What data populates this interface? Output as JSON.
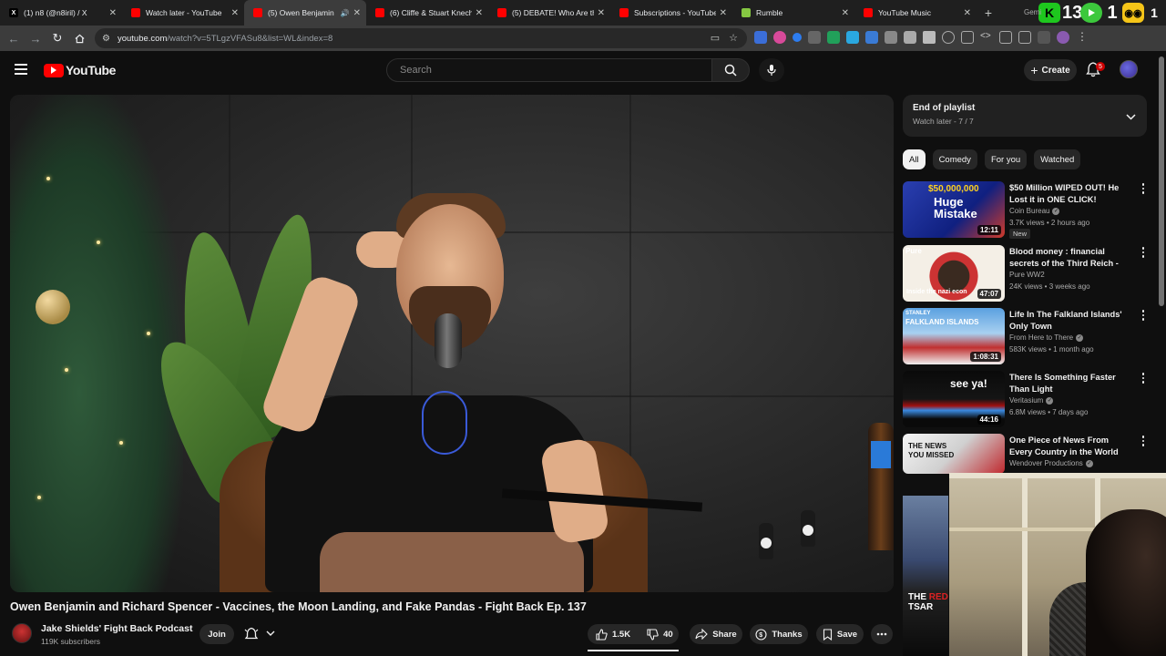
{
  "browser": {
    "tabs": [
      {
        "title": "(1) n8 (@n8iril) / X",
        "fav": "X",
        "fav_color": "#000000",
        "fav_fg": "#ffffff",
        "active": false
      },
      {
        "title": "Watch later - YouTube",
        "fav": "",
        "fav_color": "#ff0000",
        "fav_fg": "#ffffff",
        "active": false
      },
      {
        "title": "(5) Owen Benjamin",
        "fav": "",
        "fav_color": "#ff0000",
        "fav_fg": "#ffffff",
        "active": true
      },
      {
        "title": "(6) Cliffe & Stuart Knech",
        "fav": "",
        "fav_color": "#ff0000",
        "fav_fg": "#ffffff",
        "active": false
      },
      {
        "title": "(5) DEBATE! Who Are th",
        "fav": "",
        "fav_color": "#ff0000",
        "fav_fg": "#ffffff",
        "active": false
      },
      {
        "title": "Subscriptions - YouTube",
        "fav": "",
        "fav_color": "#ff0000",
        "fav_fg": "#ffffff",
        "active": false
      },
      {
        "title": "Rumble",
        "fav": "",
        "fav_color": "#85c742",
        "fav_fg": "#ffffff",
        "active": false
      },
      {
        "title": "YouTube Music",
        "fav": "",
        "fav_color": "#ff0000",
        "fav_fg": "#ffffff",
        "active": false
      }
    ],
    "ext_counter": "13",
    "ext_counter2": "1",
    "gemini_fragment": "Gemi",
    "url_host": "youtube.com",
    "url_rest": "/watch?v=5TLgzVFASu8&list=WL&index=8"
  },
  "youtube": {
    "logo_text": "YouTube",
    "search_placeholder": "Search",
    "create_label": "Create",
    "notif_count": "5"
  },
  "video": {
    "title": "Owen Benjamin and Richard Spencer - Vaccines, the Moon Landing, and Fake Pandas - Fight Back Ep. 137",
    "channel": "Jake Shields' Fight Back Podcast",
    "subscribers": "119K subscribers",
    "join_label": "Join",
    "likes": "1.5K",
    "dislikes": "40",
    "share_label": "Share",
    "thanks_label": "Thanks",
    "save_label": "Save"
  },
  "playlist": {
    "title": "End of playlist",
    "subtitle": "Watch later - 7 / 7"
  },
  "chips": [
    "All",
    "Comedy",
    "For you",
    "Watched"
  ],
  "recommendations": [
    {
      "title": "$50 Million WIPED OUT! He Lost it in ONE CLICK!",
      "channel": "Coin Bureau",
      "meta": "3.7K views • 2 hours ago",
      "duration": "12:11",
      "badge": "New",
      "thumb_text": "$50,000,000",
      "thumb_text2": "Huge Mistake"
    },
    {
      "title": "Blood money : financial secrets of the Third Reich - episode 1 :...",
      "channel": "Pure WW2",
      "meta": "24K views • 3 weeks ago",
      "duration": "47:07",
      "badge": "",
      "thumb_text": "Pure",
      "thumb_text2": "Inside the nazi econ"
    },
    {
      "title": "Life In The Falkland Islands' Only Town",
      "channel": "From Here to There",
      "meta": "583K views • 1 month ago",
      "duration": "1:08:31",
      "badge": "",
      "thumb_text": "STANLEY",
      "thumb_text2": "FALKLAND ISLANDS"
    },
    {
      "title": "There Is Something Faster Than Light",
      "channel": "Veritasium",
      "meta": "6.8M views • 7 days ago",
      "duration": "44:16",
      "badge": "",
      "thumb_text": "see ya!",
      "thumb_text2": ""
    },
    {
      "title": "One Piece of News From Every Country in the World",
      "channel": "Wendover Productions",
      "meta": "",
      "duration": "",
      "badge": "",
      "thumb_text": "THE NEWS",
      "thumb_text2": "YOU MISSED"
    }
  ],
  "overlay_text": {
    "line1": "THE",
    "line1_red": "RED",
    "line2": "TSAR"
  }
}
